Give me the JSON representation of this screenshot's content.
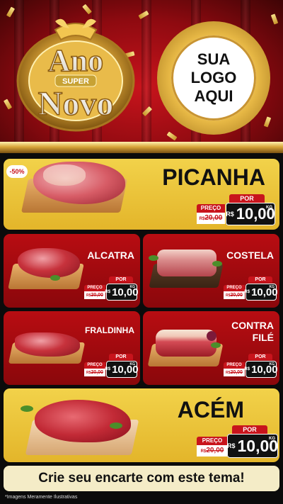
{
  "banner": {
    "badge_word_1": "Ano",
    "badge_word_2": "SUPER",
    "badge_word_3": "Novo",
    "logo_line_1": "SUA",
    "logo_line_2": "LOGO",
    "logo_line_3": "AQUI"
  },
  "discount_badge": "-50%",
  "products": [
    {
      "name": "PICANHA",
      "por_label": "POR",
      "preco_label": "PREÇO",
      "old_prefix": "R$",
      "old_price": "20,00",
      "new_prefix": "R$",
      "new_price": "10,00",
      "unit": "KG"
    },
    {
      "name": "ALCATRA",
      "por_label": "POR",
      "preco_label": "PREÇO",
      "old_prefix": "R$",
      "old_price": "20,00",
      "new_prefix": "R$",
      "new_price": "10,00",
      "unit": "KG"
    },
    {
      "name": "COSTELA",
      "por_label": "POR",
      "preco_label": "PREÇO",
      "old_prefix": "R$",
      "old_price": "20,00",
      "new_prefix": "R$",
      "new_price": "10,00",
      "unit": "KG"
    },
    {
      "name": "FRALDINHA",
      "por_label": "POR",
      "preco_label": "PREÇO",
      "old_prefix": "R$",
      "old_price": "20,00",
      "new_prefix": "R$",
      "new_price": "10,00",
      "unit": "KG"
    },
    {
      "name_line_1": "CONTRA",
      "name_line_2": "FILÉ",
      "por_label": "POR",
      "preco_label": "PREÇO",
      "old_prefix": "R$",
      "old_price": "20,00",
      "new_prefix": "R$",
      "new_price": "10,00",
      "unit": "KG"
    },
    {
      "name": "ACÉM",
      "por_label": "POR",
      "preco_label": "PREÇO",
      "old_prefix": "R$",
      "old_price": "20,00",
      "new_prefix": "R$",
      "new_price": "10,00",
      "unit": "KG"
    }
  ],
  "cta": "Crie seu encarte com este tema!",
  "footnote": "*Imagens Meramente Ilustrativas",
  "colors": {
    "red": "#c8141c",
    "gold": "#e3b52a",
    "dark": "#0b0b0b"
  }
}
